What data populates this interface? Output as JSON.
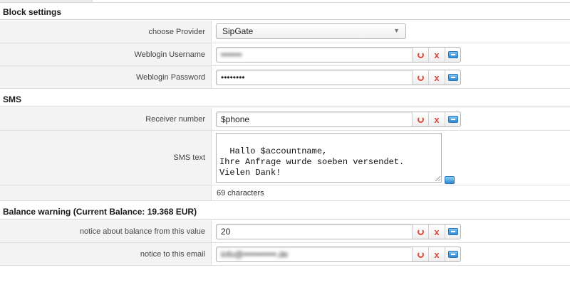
{
  "sections": {
    "block_settings": "Block settings",
    "sms": "SMS",
    "balance_warning": "Balance warning (Current Balance: 19.368 EUR)"
  },
  "block_settings": {
    "provider_label": "choose Provider",
    "provider_value": "SipGate",
    "username_label": "Weblogin Username",
    "username_value": "•••••••",
    "password_label": "Weblogin Password",
    "password_value": "••••••••"
  },
  "sms": {
    "receiver_label": "Receiver number",
    "receiver_value": "$phone",
    "text_label": "SMS text",
    "text_value": "Hallo $accountname,\nIhre Anfrage wurde soeben versendet.\nVielen Dank!",
    "char_count": "69 characters"
  },
  "balance": {
    "threshold_label": "notice about balance from this value",
    "threshold_value": "20",
    "email_label": "notice to this email",
    "email_value": "info@•••••••••••.de"
  },
  "icons": {
    "reset": "reset-icon",
    "clear": "x",
    "variables": "variables-icon"
  },
  "colors": {
    "label_bg": "#f3f3f3",
    "reset_red": "#e04a3a",
    "vars_blue": "#2f89d2"
  }
}
